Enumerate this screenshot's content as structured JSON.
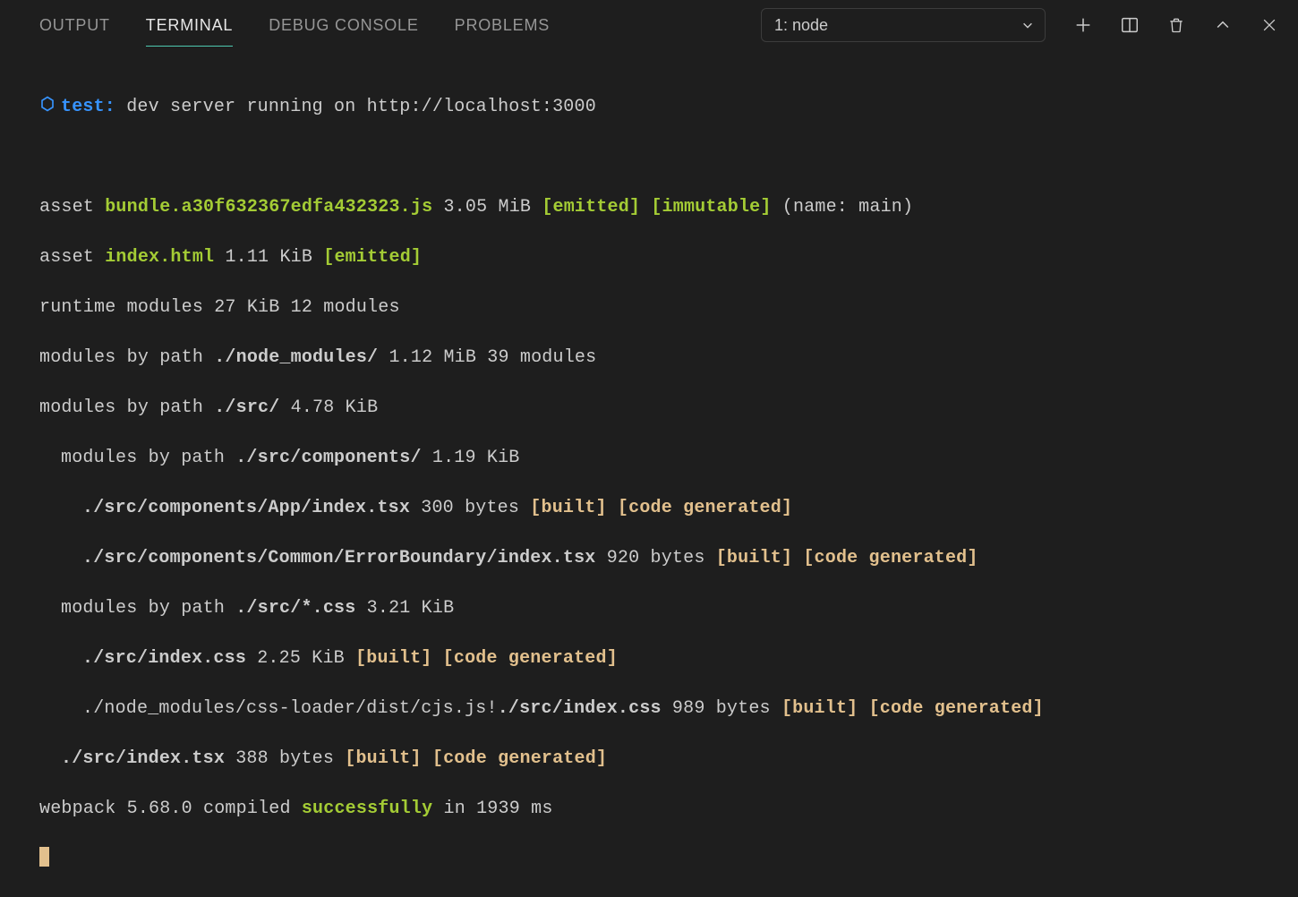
{
  "tabs": {
    "output": "OUTPUT",
    "terminal": "TERMINAL",
    "debug": "DEBUG CONSOLE",
    "problems": "PROBLEMS"
  },
  "selector": {
    "label": "1: node"
  },
  "line1": {
    "prefix": "test:",
    "rest": " dev server running on http://localhost:3000"
  },
  "asset1": {
    "lead": "asset ",
    "file": "bundle.a30f632367edfa432323.js",
    "size": " 3.05 MiB ",
    "tags": "[emitted] [immutable]",
    "tail": " (name: main)"
  },
  "asset2": {
    "lead": "asset ",
    "file": "index.html",
    "size": " 1.11 KiB ",
    "tags": "[emitted]"
  },
  "runtime": "runtime modules 27 KiB 12 modules",
  "byNode": {
    "lead": "modules by path ",
    "path": "./node_modules/",
    "tail": " 1.12 MiB 39 modules"
  },
  "bySrc": {
    "lead": "modules by path ",
    "path": "./src/",
    "tail": " 4.78 KiB"
  },
  "byComp": {
    "lead": "modules by path ",
    "path": "./src/components/",
    "tail": " 1.19 KiB"
  },
  "modApp": {
    "path": "./src/components/App/index.tsx",
    "size": " 300 bytes ",
    "tags": "[built] [code generated]"
  },
  "modErr": {
    "path": "./src/components/Common/ErrorBoundary/index.tsx",
    "size": " 920 bytes ",
    "tags": "[built] [code generated]"
  },
  "byCss": {
    "lead": "modules by path ",
    "path": "./src/*.css",
    "tail": " 3.21 KiB"
  },
  "modIdxCss": {
    "path": "./src/index.css",
    "size": " 2.25 KiB ",
    "tags": "[built] [code generated]"
  },
  "modLoader": {
    "pre": "./node_modules/css-loader/dist/cjs.js!",
    "path": "./src/index.css",
    "size": " 989 bytes ",
    "tags": "[built] [code generated]"
  },
  "modIdxTsx": {
    "path": "./src/index.tsx",
    "size": " 388 bytes ",
    "tags": "[built] [code generated]"
  },
  "final": {
    "pre": "webpack 5.68.0 compiled ",
    "ok": "successfully",
    "post": " in 1939 ms"
  }
}
